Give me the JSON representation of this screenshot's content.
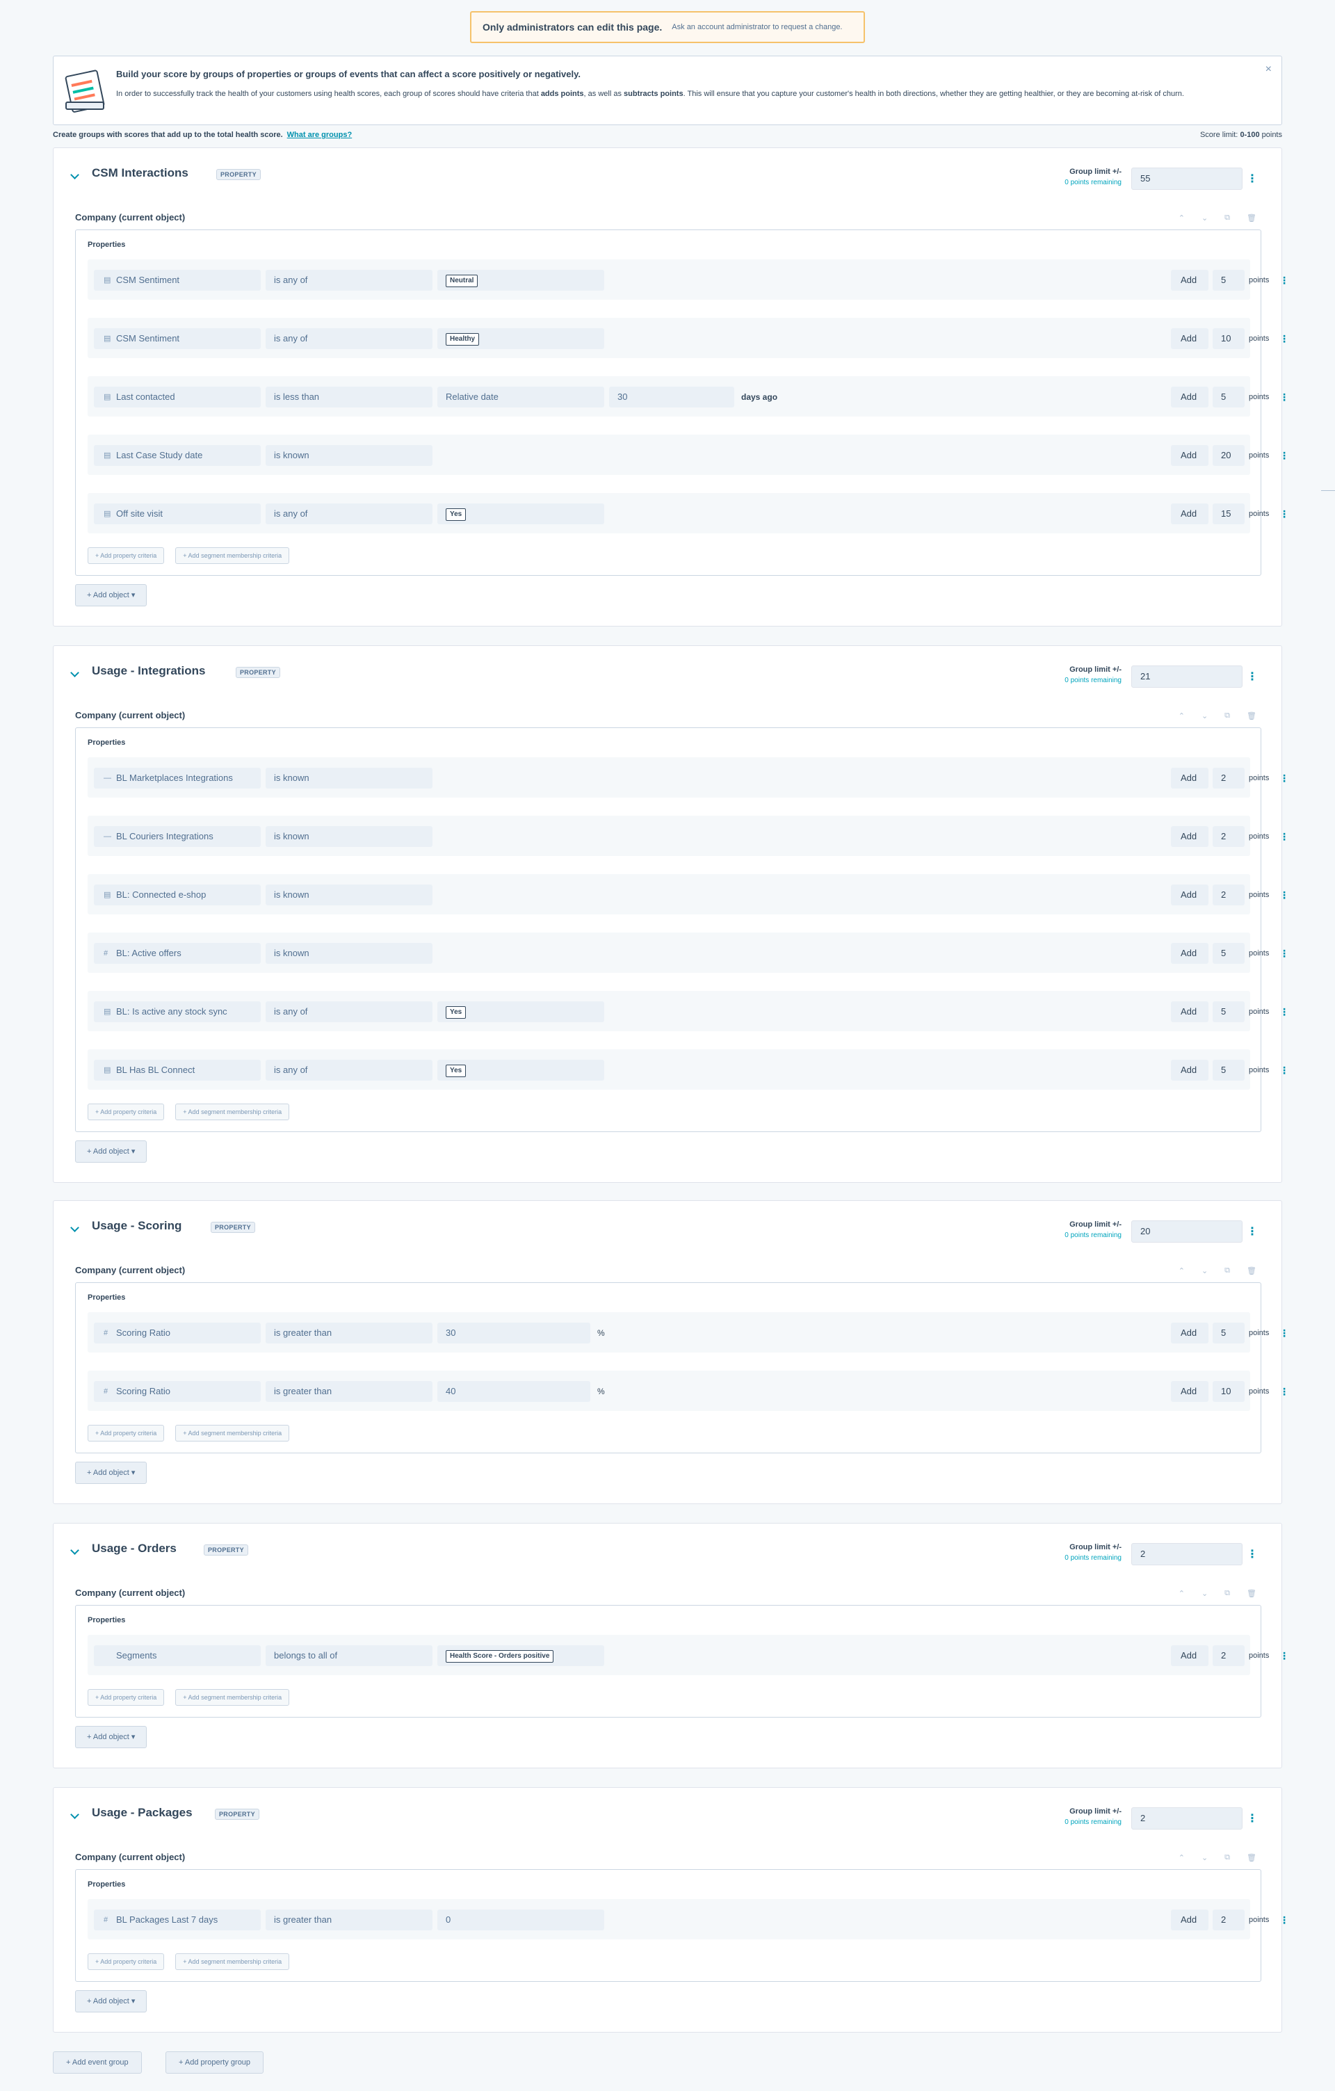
{
  "banner": {
    "title": "Only administrators can edit this page.",
    "subtitle": "Ask an account administrator to request a change."
  },
  "info": {
    "title": "Build your score by groups of properties or groups of events that can affect a score positively or negatively.",
    "body_start": "In order to successfully track the health of your customers using health scores, each group of scores should have criteria that ",
    "adds_points": "adds points",
    "body_mid": ", as well as ",
    "subtracts_points": "subtracts points",
    "body_end": ". This will ensure that you capture your customer's health in both directions, whether they are getting healthier, or they are becoming at-risk of churn.",
    "close_icon": "×"
  },
  "toolbar": {
    "create_text": "Create groups with scores that add up to the total health score.",
    "what_are_groups": "What are groups?",
    "score_limit_label": "Score limit: ",
    "score_limit_value": "0-100",
    "score_limit_unit": " points"
  },
  "common": {
    "group_limit_label": "Group limit +/-",
    "points_remaining": "0 points remaining",
    "object_title": "Company (current object)",
    "properties_label": "Properties",
    "add_label": "Add",
    "points_label": "points",
    "add_property_criteria": "+ Add property criteria",
    "add_segment_criteria": "+ Add segment membership criteria",
    "add_object": "+ Add object ▾",
    "ctrl_up": "⌃",
    "ctrl_down": "⌄",
    "ctrl_copy": "⧉",
    "ctrl_delete": "🗑",
    "menu_icon": "⋮"
  },
  "groups": [
    {
      "title": "CSM Interactions",
      "tag": "PROPERTY",
      "limit": "55",
      "rows": [
        {
          "icon": "▤",
          "property": "CSM Sentiment",
          "operator": "is any of",
          "chip": "Neutral",
          "points": "5"
        },
        {
          "icon": "▤",
          "property": "CSM Sentiment",
          "operator": "is any of",
          "chip": "Healthy",
          "points": "10"
        },
        {
          "icon": "▤",
          "property": "Last contacted",
          "operator": "is less than",
          "value": "Relative date",
          "number": "30",
          "suffix": "days ago",
          "points": "5"
        },
        {
          "icon": "▤",
          "property": "Last Case Study date",
          "operator": "is known",
          "points": "20"
        },
        {
          "icon": "▤",
          "property": "Off site visit",
          "operator": "is any of",
          "chip": "Yes",
          "points": "15"
        }
      ]
    },
    {
      "title": "Usage - Integrations",
      "tag": "PROPERTY",
      "limit": "21",
      "rows": [
        {
          "icon": "—",
          "property": "BL Marketplaces Integrations",
          "operator": "is known",
          "points": "2"
        },
        {
          "icon": "—",
          "property": "BL Couriers Integrations",
          "operator": "is known",
          "points": "2"
        },
        {
          "icon": "▤",
          "property": "BL: Connected e-shop",
          "operator": "is known",
          "points": "2"
        },
        {
          "icon": "#",
          "property": "BL: Active offers",
          "operator": "is known",
          "points": "5"
        },
        {
          "icon": "▤",
          "property": "BL: Is active any stock sync",
          "operator": "is any of",
          "chip": "Yes",
          "points": "5"
        },
        {
          "icon": "▤",
          "property": "BL Has BL Connect",
          "operator": "is any of",
          "chip": "Yes",
          "points": "5"
        }
      ]
    },
    {
      "title": "Usage - Scoring",
      "tag": "PROPERTY",
      "limit": "20",
      "rows": [
        {
          "icon": "#",
          "property": "Scoring Ratio",
          "operator": "is greater than",
          "value": "30",
          "suffix": "%",
          "points": "5"
        },
        {
          "icon": "#",
          "property": "Scoring Ratio",
          "operator": "is greater than",
          "value": "40",
          "suffix": "%",
          "points": "10"
        }
      ]
    },
    {
      "title": "Usage - Orders",
      "tag": "PROPERTY",
      "limit": "2",
      "rows": [
        {
          "icon": "",
          "property": "Segments",
          "operator": "belongs to all of",
          "chip": "Health Score - Orders positive",
          "points": "2"
        }
      ]
    },
    {
      "title": "Usage - Packages",
      "tag": "PROPERTY",
      "limit": "2",
      "rows": [
        {
          "icon": "#",
          "property": "BL Packages Last 7 days",
          "operator": "is greater than",
          "value": "0",
          "points": "2"
        }
      ]
    }
  ],
  "footer": {
    "add_event_group": "+ Add event group",
    "add_property_group": "+ Add property group"
  }
}
